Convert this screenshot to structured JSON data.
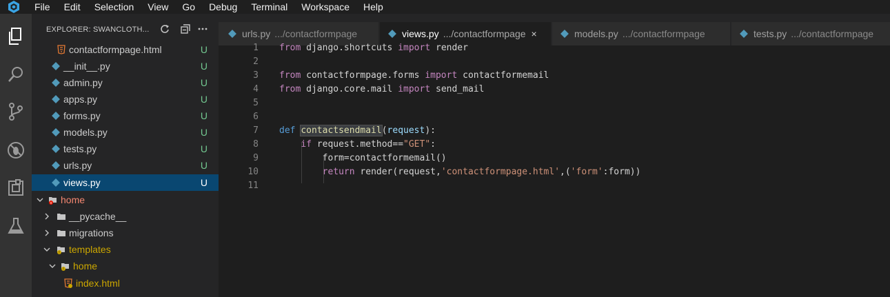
{
  "menubar": {
    "items": [
      "File",
      "Edit",
      "Selection",
      "View",
      "Go",
      "Debug",
      "Terminal",
      "Workspace",
      "Help"
    ]
  },
  "activity_bar": {
    "icons": [
      "files-icon",
      "search-icon",
      "source-control-icon",
      "debug-icon",
      "extensions-icon",
      "test-flask-icon"
    ]
  },
  "explorer": {
    "title": "EXPLORER: SWANCLOTH...",
    "actions": [
      "refresh-icon",
      "collapse-all-icon",
      "more-icon"
    ],
    "items": [
      {
        "label": "contactformpage.html",
        "status": "U",
        "kind": "html"
      },
      {
        "label": "__init__.py",
        "status": "U",
        "kind": "py"
      },
      {
        "label": "admin.py",
        "status": "U",
        "kind": "py"
      },
      {
        "label": "apps.py",
        "status": "U",
        "kind": "py"
      },
      {
        "label": "forms.py",
        "status": "U",
        "kind": "py"
      },
      {
        "label": "models.py",
        "status": "U",
        "kind": "py"
      },
      {
        "label": "tests.py",
        "status": "U",
        "kind": "py"
      },
      {
        "label": "urls.py",
        "status": "U",
        "kind": "py"
      },
      {
        "label": "views.py",
        "status": "U",
        "kind": "py",
        "selected": true
      },
      {
        "label": "home",
        "kind": "folder-open",
        "badge": "error"
      },
      {
        "label": "__pycache__",
        "kind": "folder"
      },
      {
        "label": "migrations",
        "kind": "folder"
      },
      {
        "label": "templates",
        "kind": "folder-open",
        "badge": "warning"
      },
      {
        "label": "home",
        "kind": "folder-open",
        "badge": "warning"
      },
      {
        "label": "index.html",
        "kind": "html",
        "badge": "warning"
      }
    ]
  },
  "tabs": [
    {
      "name": "urls.py",
      "path": ".../contactformpage",
      "active": false
    },
    {
      "name": "views.py",
      "path": ".../contactformpage",
      "active": true,
      "close": "×"
    },
    {
      "name": "models.py",
      "path": ".../contactformpage",
      "active": false
    },
    {
      "name": "tests.py",
      "path": ".../contactformpage",
      "active": false
    }
  ],
  "editor": {
    "line_numbers": [
      "1",
      "2",
      "3",
      "4",
      "5",
      "6",
      "7",
      "8",
      "9",
      "10",
      "11"
    ],
    "lines": {
      "l1": {
        "a": "from",
        "b": " django.shortcuts ",
        "c": "import",
        "d": " render"
      },
      "l3": {
        "a": "from",
        "b": " contactformpage.forms ",
        "c": "import",
        "d": " contactformemail"
      },
      "l4": {
        "a": "from",
        "b": " django.core.mail ",
        "c": "import",
        "d": " send_mail"
      },
      "l7": {
        "a": "def",
        "b": " ",
        "c": "contactsendmail",
        "d": "(",
        "e": "request",
        "f": "):"
      },
      "l8": {
        "a": "    ",
        "b": "if",
        "c": " request.method==",
        "d": "\"GET\"",
        "e": ":"
      },
      "l9": {
        "a": "        form=contactformemail()"
      },
      "l10": {
        "a": "        ",
        "b": "return",
        "c": " render(request,",
        "d": "'contactformpage.html'",
        "e": ",(",
        "f": "'form'",
        "g": ":form))"
      }
    }
  },
  "colors": {
    "activity_bar": "#333333",
    "sidebar": "#252526",
    "editor": "#1e1e1e",
    "selection": "#094771",
    "untracked": "#73c991",
    "keyword": "#c586c0",
    "string": "#ce9178"
  }
}
